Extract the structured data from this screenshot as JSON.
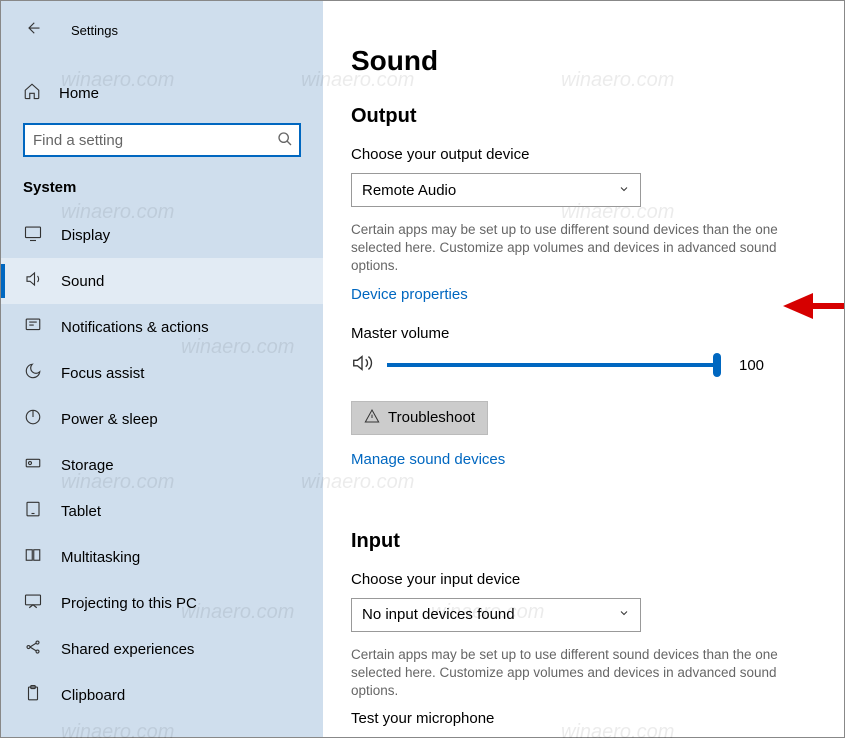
{
  "window": {
    "title": "Settings"
  },
  "sidebar": {
    "home": "Home",
    "search_placeholder": "Find a setting",
    "group": "System",
    "items": [
      {
        "label": "Display",
        "icon": "display-icon"
      },
      {
        "label": "Sound",
        "icon": "sound-icon",
        "active": true
      },
      {
        "label": "Notifications & actions",
        "icon": "notifications-icon"
      },
      {
        "label": "Focus assist",
        "icon": "focus-icon"
      },
      {
        "label": "Power & sleep",
        "icon": "power-icon"
      },
      {
        "label": "Storage",
        "icon": "storage-icon"
      },
      {
        "label": "Tablet",
        "icon": "tablet-icon"
      },
      {
        "label": "Multitasking",
        "icon": "multitasking-icon"
      },
      {
        "label": "Projecting to this PC",
        "icon": "projecting-icon"
      },
      {
        "label": "Shared experiences",
        "icon": "shared-icon"
      },
      {
        "label": "Clipboard",
        "icon": "clipboard-icon"
      }
    ]
  },
  "page": {
    "title": "Sound",
    "output": {
      "heading": "Output",
      "choose_label": "Choose your output device",
      "selected": "Remote Audio",
      "hint": "Certain apps may be set up to use different sound devices than the one selected here. Customize app volumes and devices in advanced sound options.",
      "device_props": "Device properties",
      "master_label": "Master volume",
      "volume": "100",
      "troubleshoot": "Troubleshoot",
      "manage": "Manage sound devices"
    },
    "input": {
      "heading": "Input",
      "choose_label": "Choose your input device",
      "selected": "No input devices found",
      "hint": "Certain apps may be set up to use different sound devices than the one selected here. Customize app volumes and devices in advanced sound options.",
      "test_label": "Test your microphone"
    }
  },
  "watermark": "winaero.com"
}
